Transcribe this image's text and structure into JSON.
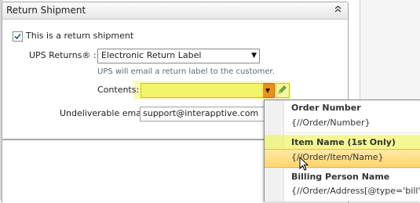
{
  "panel": {
    "title": "Return Shipment"
  },
  "return_checkbox": {
    "label": "This is a return shipment",
    "checked": true
  },
  "ups_returns": {
    "label": "UPS Returns® :",
    "selected": "Electronic Return Label",
    "hint": "UPS will email a return label to the customer."
  },
  "contents": {
    "label": "Contents:",
    "value": ""
  },
  "undeliverable": {
    "label": "Undeliverable email:",
    "value": "support@interapptive.com"
  },
  "popup": {
    "items": [
      {
        "title": "Order Number",
        "path": "{//Order/Number}"
      },
      {
        "title": "Item Name (1st Only)",
        "path": "{//Order/Item/Name}"
      },
      {
        "title": "Billing Person Name",
        "path": "{//Order/Address[@type='bill']/"
      }
    ]
  },
  "colors": {
    "highlight_yellow": "#f0f56a",
    "dropdown_orange": "#ef8f1b",
    "hover_gold": "#ffd56a"
  }
}
